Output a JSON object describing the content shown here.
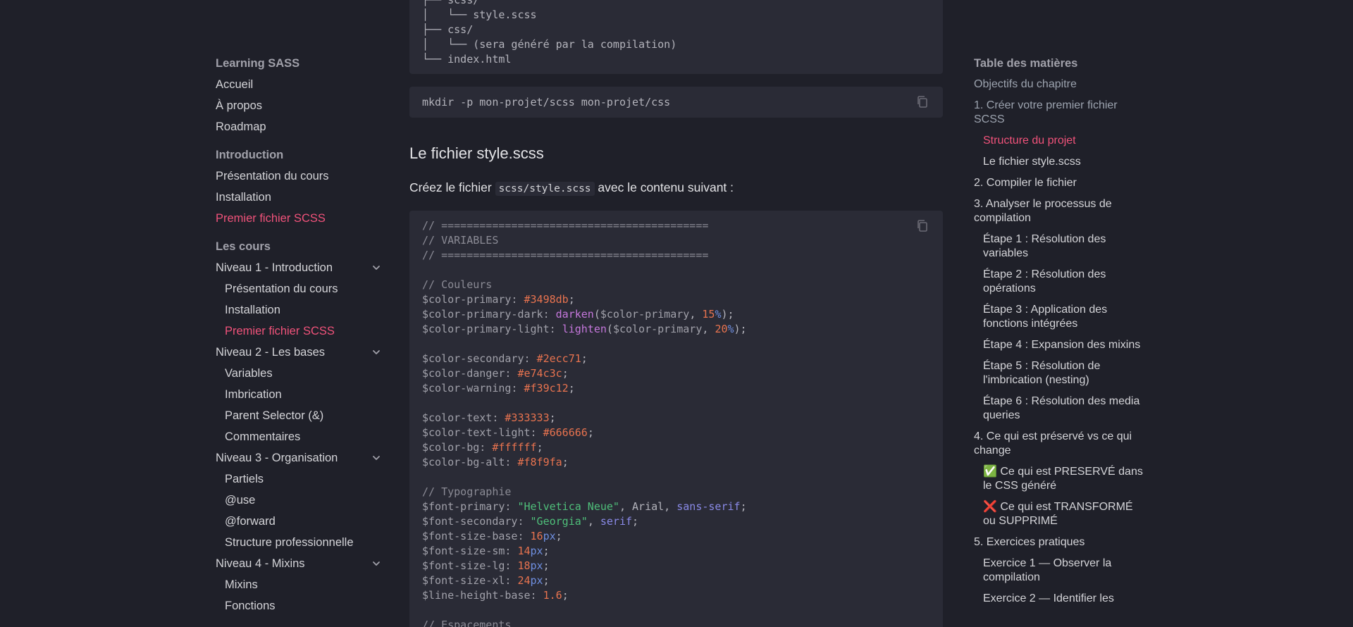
{
  "sidebar": {
    "sections": [
      {
        "title": "Learning SASS",
        "items": [
          "Accueil",
          "À propos",
          "Roadmap"
        ]
      },
      {
        "title": "Introduction",
        "items": [
          "Présentation du cours",
          "Installation",
          "Premier fichier SCSS"
        ]
      },
      {
        "title": "Les cours"
      }
    ],
    "niveaux": [
      {
        "label": "Niveau 1 - Introduction",
        "items": [
          "Présentation du cours",
          "Installation",
          "Premier fichier SCSS"
        ]
      },
      {
        "label": "Niveau 2 - Les bases",
        "items": [
          "Variables",
          "Imbrication",
          "Parent Selector (&)",
          "Commentaires"
        ]
      },
      {
        "label": "Niveau 3 - Organisation",
        "items": [
          "Partiels",
          "@use",
          "@forward",
          "Structure professionnelle"
        ]
      },
      {
        "label": "Niveau 4 - Mixins",
        "items": [
          "Mixins",
          "Fonctions"
        ]
      }
    ]
  },
  "main": {
    "tree_lines": [
      "├── scss/",
      "│   └── style.scss",
      "├── css/",
      "│   └── (sera généré par la compilation)",
      "└── index.html"
    ],
    "cmd": "mkdir -p mon-projet/scss mon-projet/css",
    "heading": "Le fichier style.scss",
    "para_before": "Créez le fichier ",
    "para_code": "scss/style.scss",
    "para_after": " avec le contenu suivant :"
  },
  "toc": {
    "title": "Table des matières",
    "items": [
      "Objectifs du chapitre",
      "1. Créer votre premier fichier SCSS",
      "Structure du projet",
      "Le fichier style.scss",
      "2. Compiler le fichier",
      "3. Analyser le processus de compilation",
      "Étape 1 : Résolution des variables",
      "Étape 2 : Résolution des opérations",
      "Étape 3 : Application des fonctions intégrées",
      "Étape 4 : Expansion des mixins",
      "Étape 5 : Résolution de l'imbrication (nesting)",
      "Étape 6 : Résolution des media queries",
      "4. Ce qui est préservé vs ce qui change",
      "✅ Ce qui est PRESERVÉ dans le CSS généré",
      "❌ Ce qui est TRANSFORMÉ ou SUPPRIMÉ",
      "5. Exercices pratiques",
      "Exercice 1 — Observer la compilation",
      "Exercice 2 — Identifier les"
    ]
  },
  "colors": {
    "accent": "#f0527a",
    "background": "#1f2029",
    "code_bg": "#2a2b36"
  },
  "icons": [
    "chevron-down-icon",
    "copy-icon"
  ]
}
